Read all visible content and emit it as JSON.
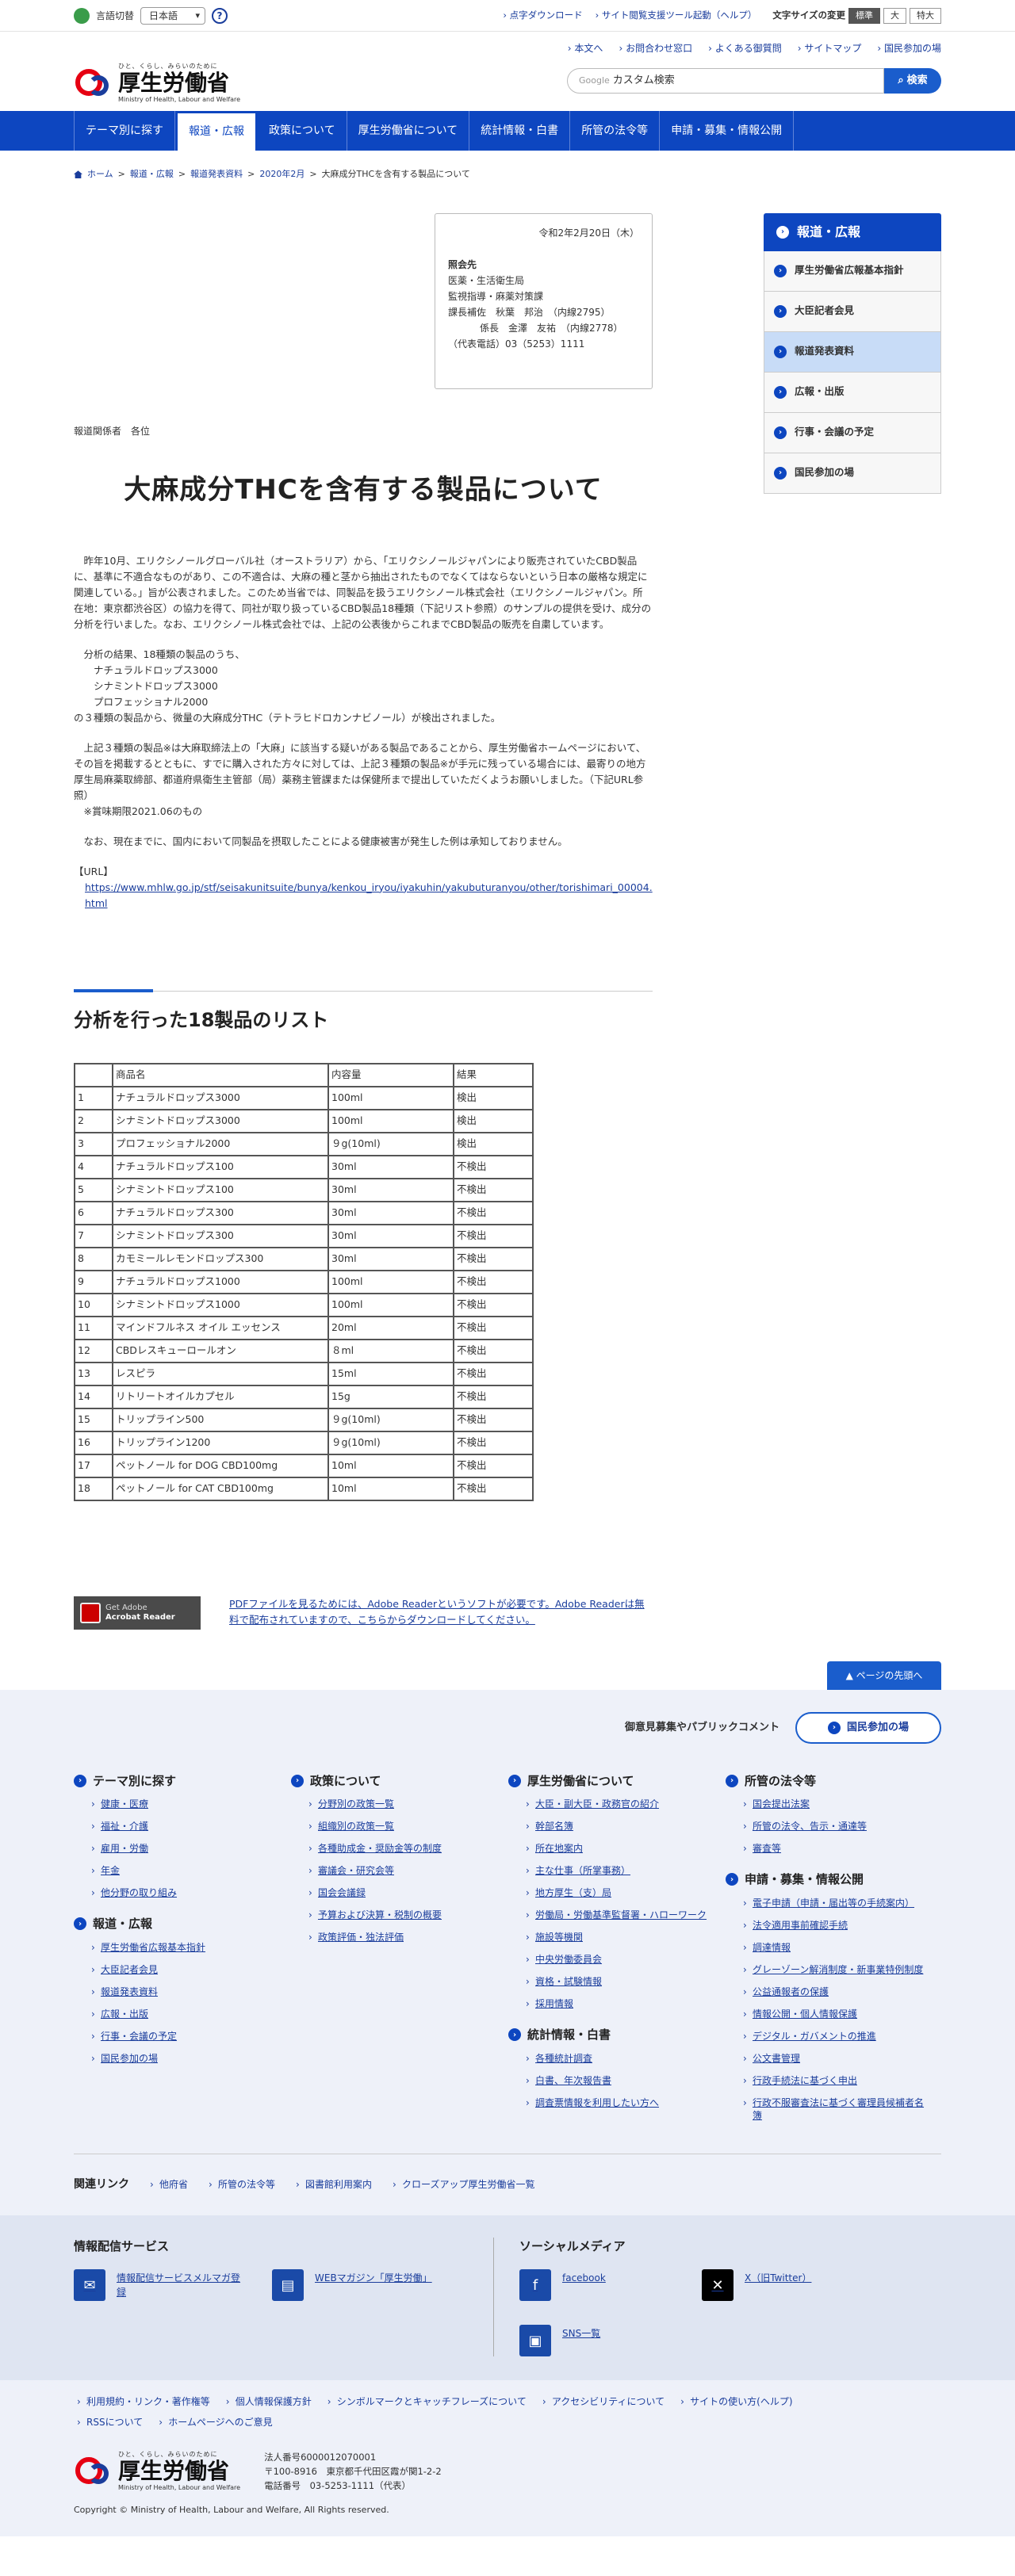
{
  "topbar": {
    "lang_label": "言語切替",
    "lang_value": "日本語",
    "links": [
      "点字ダウンロード",
      "サイト閲覧支援ツール起動（ヘルプ）"
    ],
    "fontsize_label": "文字サイズの変更",
    "fontsizes": [
      "標準",
      "大",
      "特大"
    ]
  },
  "header": {
    "tagline": "ひと、くらし、みらいのために",
    "site_name": "厚生労働省",
    "site_name_en": "Ministry of Health, Labour and Welfare",
    "links": [
      "本文へ",
      "お問合わせ窓口",
      "よくある御質問",
      "サイトマップ",
      "国民参加の場"
    ],
    "search_brand": "Google",
    "search_placeholder": "カスタム検索",
    "search_button": "検索"
  },
  "gnav": [
    "テーマ別に探す",
    "報道・広報",
    "政策について",
    "厚生労働省について",
    "統計情報・白書",
    "所管の法令等",
    "申請・募集・情報公開"
  ],
  "breadcrumb": [
    "ホーム",
    "報道・広報",
    "報道発表資料",
    "2020年2月",
    "大麻成分THCを含有する製品について"
  ],
  "contact": {
    "date": "令和2年2月20日（木）",
    "heading": "照会先",
    "lines": [
      "医薬・生活衛生局",
      "監視指導・麻薬対策課",
      "課長補佐　秋葉　邦治　（内線2795）",
      "係長　金澤　友祐　（内線2778）",
      "（代表電話）03（5253）1111"
    ]
  },
  "to": "報道関係者　各位",
  "title": "大麻成分THCを含有する製品について",
  "paragraphs": [
    "　昨年10月、エリクシノールグローバル社（オーストラリア）から、「エリクシノールジャパンにより販売されていたCBD製品に、基準に不適合なものがあり、この不適合は、大麻の種と茎から抽出されたものでなくてはならないという日本の厳格な規定に関連している。」旨が公表されました。このため当省では、同製品を扱うエリクシノール株式会社（エリクシノールジャパン。所在地：東京都渋谷区）の協力を得て、同社が取り扱っているCBD製品18種類（下記リスト参照）のサンプルの提供を受け、成分の分析を行いました。なお、エリクシノール株式会社では、上記の公表後からこれまでCBD製品の販売を自粛しています。",
    "　分析の結果、18種類の製品のうち、\n　　ナチュラルドロップス3000\n　　シナミントドロップス3000\n　　プロフェッショナル2000\nの３種類の製品から、微量の大麻成分THC（テトラヒドロカンナビノール）が検出されました。",
    "　上記３種類の製品※は大麻取締法上の「大麻」に該当する疑いがある製品であることから、厚生労働省ホームページにおいて、その旨を掲載するとともに、すでに購入された方々に対しては、上記３種類の製品※が手元に残っている場合には、最寄りの地方厚生局麻薬取締部、都道府県衛生主管部（局）薬務主管課または保健所まで提出していただくようお願いしました。（下記URL参照）\n　※賞味期限2021.06のもの",
    "　なお、現在までに、国内において同製品を摂取したことによる健康被害が発生した例は承知しておりません。"
  ],
  "url_label": "【URL】",
  "url": "https://www.mhlw.go.jp/stf/seisakunitsuite/bunya/kenkou_iryou/iyakuhin/yakubuturanyou/other/torishimari_00004.html",
  "list_heading": "分析を行った18製品のリスト",
  "table": {
    "headers": [
      "",
      "商品名",
      "内容量",
      "結果"
    ],
    "rows": [
      [
        "1",
        "ナチュラルドロップス3000",
        "100ml",
        "検出"
      ],
      [
        "2",
        "シナミントドロップス3000",
        "100ml",
        "検出"
      ],
      [
        "3",
        "プロフェッショナル2000",
        "９g(10ml)",
        "検出"
      ],
      [
        "4",
        "ナチュラルドロップス100",
        "30ml",
        "不検出"
      ],
      [
        "5",
        "シナミントドロップス100",
        "30ml",
        "不検出"
      ],
      [
        "6",
        "ナチュラルドロップス300",
        "30ml",
        "不検出"
      ],
      [
        "7",
        "シナミントドロップス300",
        "30ml",
        "不検出"
      ],
      [
        "8",
        "カモミールレモンドロップス300",
        "30ml",
        "不検出"
      ],
      [
        "9",
        "ナチュラルドロップス1000",
        "100ml",
        "不検出"
      ],
      [
        "10",
        "シナミントドロップス1000",
        "100ml",
        "不検出"
      ],
      [
        "11",
        "マインドフルネス オイル エッセンス",
        "20ml",
        "不検出"
      ],
      [
        "12",
        "CBDレスキューロールオン",
        "８ml",
        "不検出"
      ],
      [
        "13",
        "レスピラ",
        "15ml",
        "不検出"
      ],
      [
        "14",
        "リトリートオイルカプセル",
        "15g",
        "不検出"
      ],
      [
        "15",
        "トリップライン500",
        "９g(10ml)",
        "不検出"
      ],
      [
        "16",
        "トリップライン1200",
        "９g(10ml)",
        "不検出"
      ],
      [
        "17",
        "ペットノール for DOG CBD100mg",
        "10ml",
        "不検出"
      ],
      [
        "18",
        "ペットノール for CAT CBD100mg",
        "10ml",
        "不検出"
      ]
    ]
  },
  "pdf": {
    "badge_line1": "Get Adobe",
    "badge_line2": "Acrobat Reader",
    "text": "PDFファイルを見るためには、Adobe Readerというソフトが必要です。Adobe Readerは無料で配布されていますので、こちらからダウンロードしてください。"
  },
  "sidebar": {
    "title": "報道・広報",
    "items": [
      "厚生労働省広報基本指針",
      "大臣記者会見",
      "報道発表資料",
      "広報・出版",
      "行事・会議の予定",
      "国民参加の場"
    ]
  },
  "pagetop": "ページの先頭へ",
  "footer": {
    "opinion": "御意見募集やパブリックコメント",
    "opinion_btn": "国民参加の場",
    "cols": [
      [
        {
          "h": "テーマ別に探す",
          "items": [
            "健康・医療",
            "福祉・介護",
            "雇用・労働",
            "年金",
            "他分野の取り組み"
          ]
        },
        {
          "h": "報道・広報",
          "items": [
            "厚生労働省広報基本指針",
            "大臣記者会見",
            "報道発表資料",
            "広報・出版",
            "行事・会議の予定",
            "国民参加の場"
          ]
        }
      ],
      [
        {
          "h": "政策について",
          "items": [
            "分野別の政策一覧",
            "組織別の政策一覧",
            "各種助成金・奨励金等の制度",
            "審議会・研究会等",
            "国会会議録",
            "予算および決算・税制の概要",
            "政策評価・独法評価"
          ]
        }
      ],
      [
        {
          "h": "厚生労働省について",
          "items": [
            "大臣・副大臣・政務官の紹介",
            "幹部名簿",
            "所在地案内",
            "主な仕事（所掌事務）",
            "地方厚生（支）局",
            "労働局・労働基準監督署・ハローワーク",
            "施設等機関",
            "中央労働委員会",
            "資格・試験情報",
            "採用情報"
          ]
        },
        {
          "h": "統計情報・白書",
          "items": [
            "各種統計調査",
            "白書、年次報告書",
            "調査票情報を利用したい方へ"
          ]
        }
      ],
      [
        {
          "h": "所管の法令等",
          "items": [
            "国会提出法案",
            "所管の法令、告示・通達等",
            "審査等"
          ]
        },
        {
          "h": "申請・募集・情報公開",
          "items": [
            "電子申請（申請・届出等の手続案内）",
            "法令適用事前確認手続",
            "調達情報",
            "グレーゾーン解消制度・新事業特例制度",
            "公益通報者の保護",
            "情報公開・個人情報保護",
            "デジタル・ガバメントの推進",
            "公文書管理",
            "行政手続法に基づく申出",
            "行政不服審査法に基づく審理員候補者名簿"
          ]
        }
      ]
    ],
    "related_label": "関連リンク",
    "related": [
      "他府省",
      "所管の法令等",
      "図書館利用案内",
      "クローズアップ厚生労働省一覧"
    ],
    "info_heading": "情報配信サービス",
    "info_items": [
      "情報配信サービスメルマガ登録",
      "WEBマガジン「厚生労働」"
    ],
    "social_heading": "ソーシャルメディア",
    "social_items": [
      "facebook",
      "X（旧Twitter）",
      "SNS一覧"
    ],
    "fnav": [
      "利用規約・リンク・著作権等",
      "個人情報保護方針",
      "シンボルマークとキャッチフレーズについて",
      "アクセシビリティについて",
      "サイトの使い方(ヘルプ)",
      "RSSについて",
      "ホームページへのご意見"
    ],
    "corp_no": "法人番号6000012070001",
    "address": "〒100-8916　東京都千代田区霞が関1-2-2",
    "tel": "電話番号　03-5253-1111（代表）",
    "copyright": "Copyright © Ministry of Health, Labour and Welfare, All Rights reserved."
  },
  "colors": {
    "primary": "#0d46c0",
    "accent": "#e60012"
  }
}
